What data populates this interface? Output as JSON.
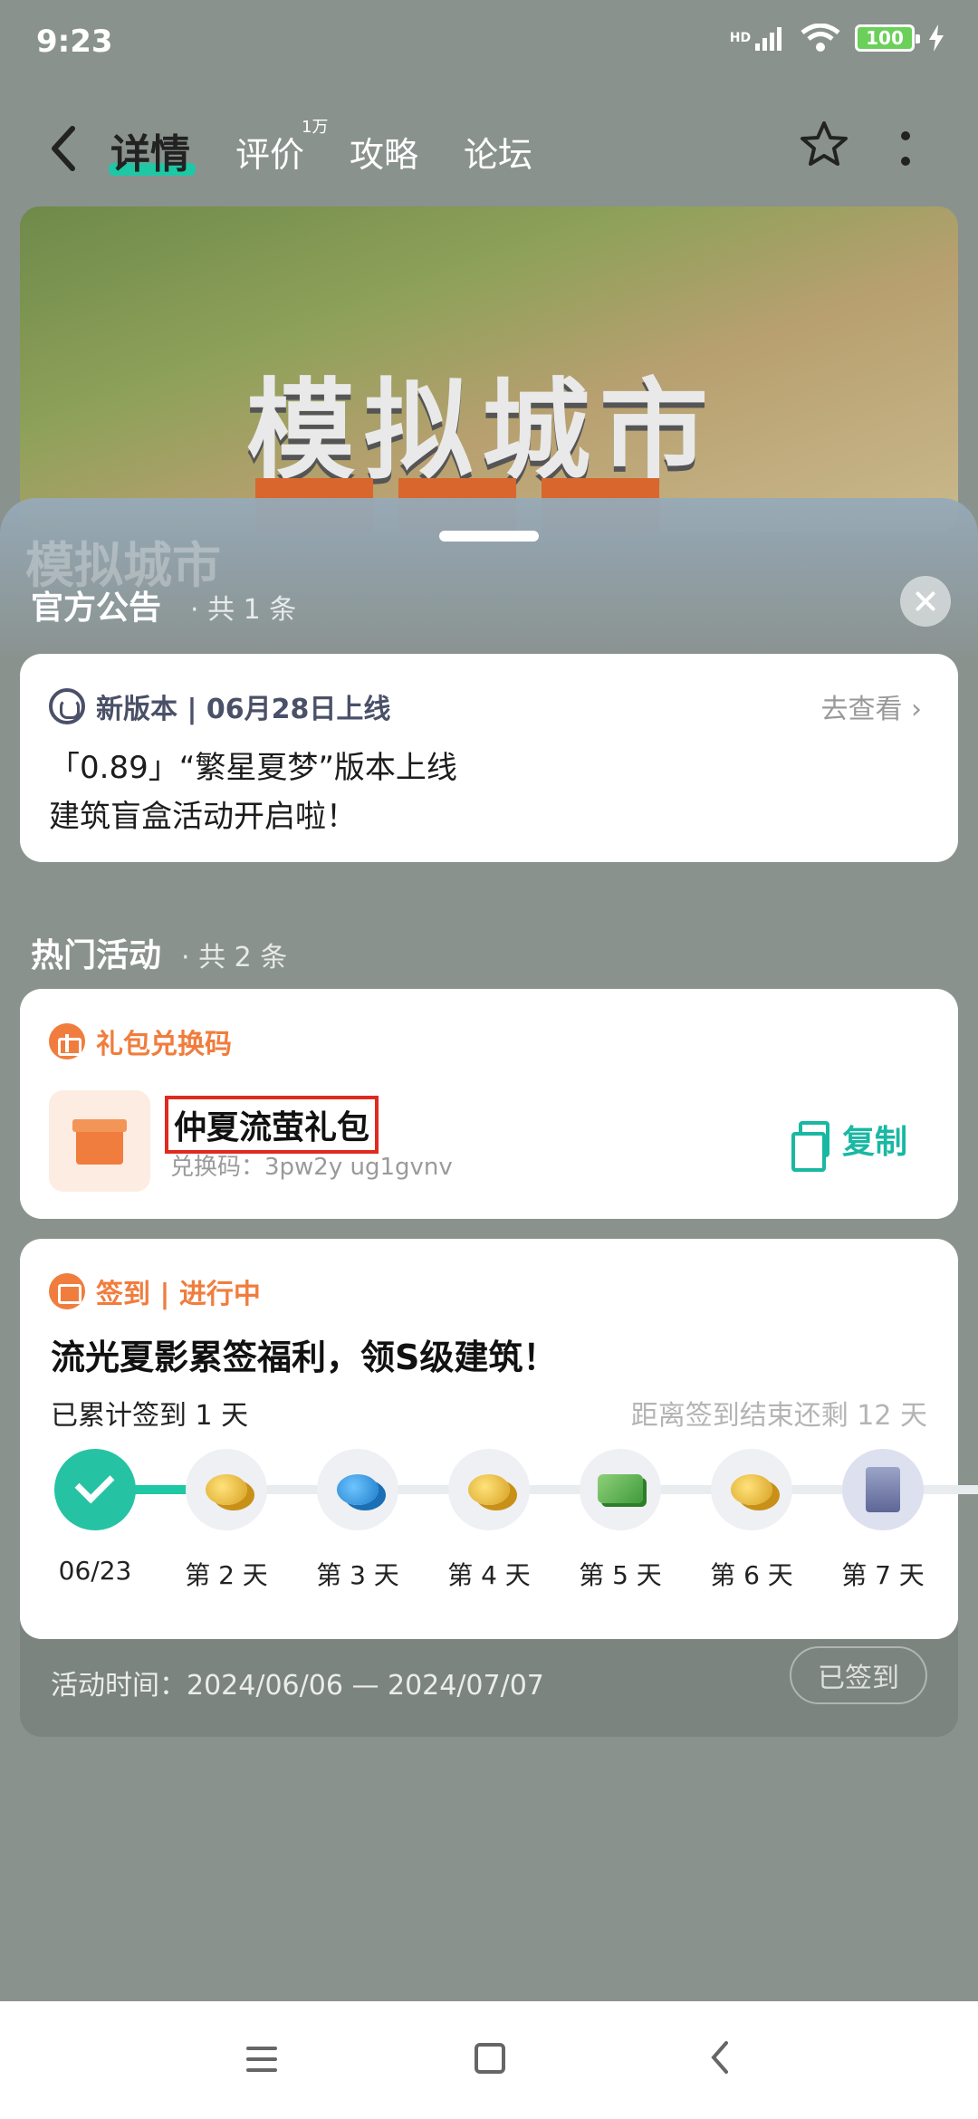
{
  "status_bar": {
    "time": "9:23",
    "signal": "HD",
    "battery": "100"
  },
  "nav": {
    "tabs": [
      {
        "label": "详情",
        "active": true
      },
      {
        "label": "评价",
        "badge": "1万"
      },
      {
        "label": "攻略"
      },
      {
        "label": "论坛"
      }
    ]
  },
  "banner": {
    "title": "模拟城市"
  },
  "sheet": {
    "watermark": "模拟城市",
    "announcements": {
      "title": "官方公告",
      "count": "· 共 1 条",
      "item": {
        "tag": "新版本 | 06月28日上线",
        "link": "去查看",
        "line1": "「0.89」“繁星夏梦”版本上线",
        "line2": "建筑盲盒活动开启啦！"
      }
    },
    "activities": {
      "title": "热门活动",
      "count": "· 共 2 条",
      "gift": {
        "header": "礼包兑换码",
        "name": "仲夏流萤礼包",
        "code": "兑换码：3pw2y        ug1gvnv",
        "copy_label": "复制"
      },
      "signin": {
        "header": "签到 | 进行中",
        "title": "流光夏影累签福利，领S级建筑！",
        "progress": "已累计签到 1 天",
        "remaining": "距离签到结束还剩  12 天",
        "days": [
          {
            "label": "06/23",
            "reward": "done"
          },
          {
            "label": "第 2 天",
            "reward": "coins"
          },
          {
            "label": "第 3 天",
            "reward": "blue"
          },
          {
            "label": "第 4 天",
            "reward": "coins"
          },
          {
            "label": "第 5 天",
            "reward": "cash"
          },
          {
            "label": "第 6 天",
            "reward": "coins"
          },
          {
            "label": "第 7 天",
            "reward": "build"
          }
        ],
        "activity_time": "活动时间：2024/06/06 — 2024/07/07",
        "signed_label": "已签到"
      }
    }
  },
  "colors": {
    "accent": "#1ec8a5",
    "orange": "#f07d3e",
    "copy": "#19b8a2",
    "highlight_box": "#e02a1f"
  }
}
